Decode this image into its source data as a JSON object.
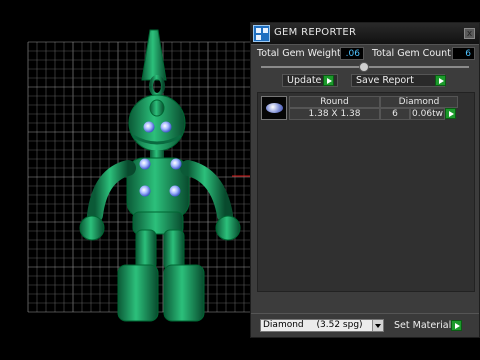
{
  "panel": {
    "title": "GEM REPORTER",
    "close_label": "x",
    "total_weight_label": "Total Gem Weight",
    "total_weight_value": ".06",
    "total_count_label": "Total Gem Count",
    "total_count_value": "6",
    "update_label": "Update",
    "save_report_label": "Save Report",
    "table": {
      "headers": [
        "Round",
        "Diamond"
      ],
      "row": {
        "size": "1.38 X 1.38",
        "count": "6",
        "weight": "0.06tw"
      }
    },
    "material_select_value": "Diamond",
    "material_select_spg": "(3.52 spg)",
    "set_material_label": "Set Material"
  },
  "colors": {
    "model": "#1aa165",
    "gem": "#8fa8ff",
    "accent_go": "#1c9a2c",
    "value_text": "#4fc3ff"
  }
}
